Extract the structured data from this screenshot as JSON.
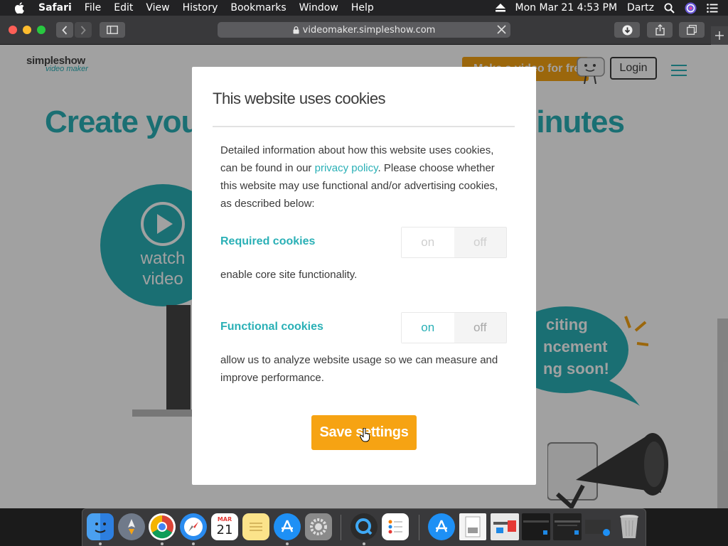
{
  "menubar": {
    "apple": "apple-logo",
    "app_name": "Safari",
    "menus": [
      "File",
      "Edit",
      "View",
      "History",
      "Bookmarks",
      "Window",
      "Help"
    ],
    "datetime": "Mon Mar 21  4:53 PM",
    "user": "Dartz"
  },
  "toolbar": {
    "url": "videomaker.simpleshow.com"
  },
  "site": {
    "logo_main": "simpleshow",
    "logo_sub": "video maker",
    "make_video_label": "Make a video for free",
    "login_label": "Login",
    "headline": "Create your s                              in minutes",
    "watch_label": "watch video",
    "bubble_text_1": "citing",
    "bubble_text_2": "ncement",
    "bubble_text_3": "ng soon!"
  },
  "modal": {
    "title": "This website uses cookies",
    "desc_before_link": "Detailed information about how this website uses cookies, can be found in our ",
    "link_text": "privacy policy",
    "desc_after_link": ". Please choose whether this website may use functional and/or advertising cookies, as described below:",
    "required": {
      "label": "Required cookies",
      "on_label": "on",
      "off_label": "off",
      "description": "enable core site functionality."
    },
    "functional": {
      "label": "Functional cookies",
      "on_label": "on",
      "off_label": "off",
      "description": "allow us to analyze website usage so we can measure and improve performance."
    },
    "save_label": "Save settings"
  },
  "dock": {
    "apps": [
      "finder-icon",
      "launchpad-icon",
      "chrome-icon",
      "safari-icon",
      "calendar-icon",
      "notes-icon",
      "app-store-icon",
      "system-preferences-icon",
      "quicktime-icon",
      "reminders-icon",
      "app-store-downloads-icon",
      "document-icon",
      "window-thumbnail-1-icon",
      "window-thumbnail-2-icon",
      "window-thumbnail-3-icon",
      "trash-icon"
    ],
    "calendar_month": "MAR",
    "calendar_day": "21"
  },
  "colors": {
    "accent": "#2ab0b6",
    "orange": "#f6a313"
  }
}
